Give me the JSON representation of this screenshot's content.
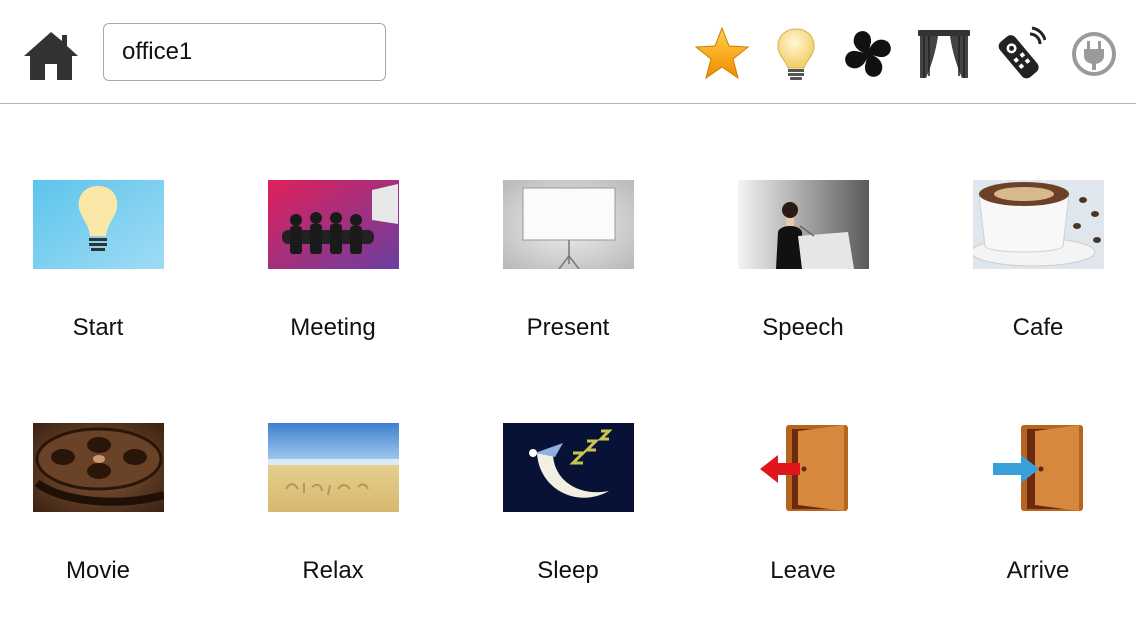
{
  "header": {
    "home_icon": "home-icon",
    "room_value": "office1",
    "icons": [
      {
        "name": "favorites-star-icon",
        "color": "#f7a21b"
      },
      {
        "name": "light-bulb-icon",
        "color": "#f6d97a"
      },
      {
        "name": "fan-icon",
        "color": "#111111"
      },
      {
        "name": "curtain-icon",
        "color": "#333333"
      },
      {
        "name": "remote-control-icon",
        "color": "#222222"
      },
      {
        "name": "power-plug-icon",
        "color": "#9a9a9a"
      }
    ]
  },
  "scenes": [
    {
      "label": "Start",
      "icon": "light-bulb-scene-icon"
    },
    {
      "label": "Meeting",
      "icon": "meeting-scene-icon"
    },
    {
      "label": "Present",
      "icon": "projector-screen-scene-icon"
    },
    {
      "label": "Speech",
      "icon": "speaker-podium-scene-icon"
    },
    {
      "label": "Cafe",
      "icon": "coffee-cup-scene-icon"
    },
    {
      "label": "Movie",
      "icon": "film-reel-scene-icon"
    },
    {
      "label": "Relax",
      "icon": "beach-scene-icon"
    },
    {
      "label": "Sleep",
      "icon": "sleeping-moon-scene-icon"
    },
    {
      "label": "Leave",
      "icon": "door-exit-scene-icon"
    },
    {
      "label": "Arrive",
      "icon": "door-enter-scene-icon"
    }
  ]
}
